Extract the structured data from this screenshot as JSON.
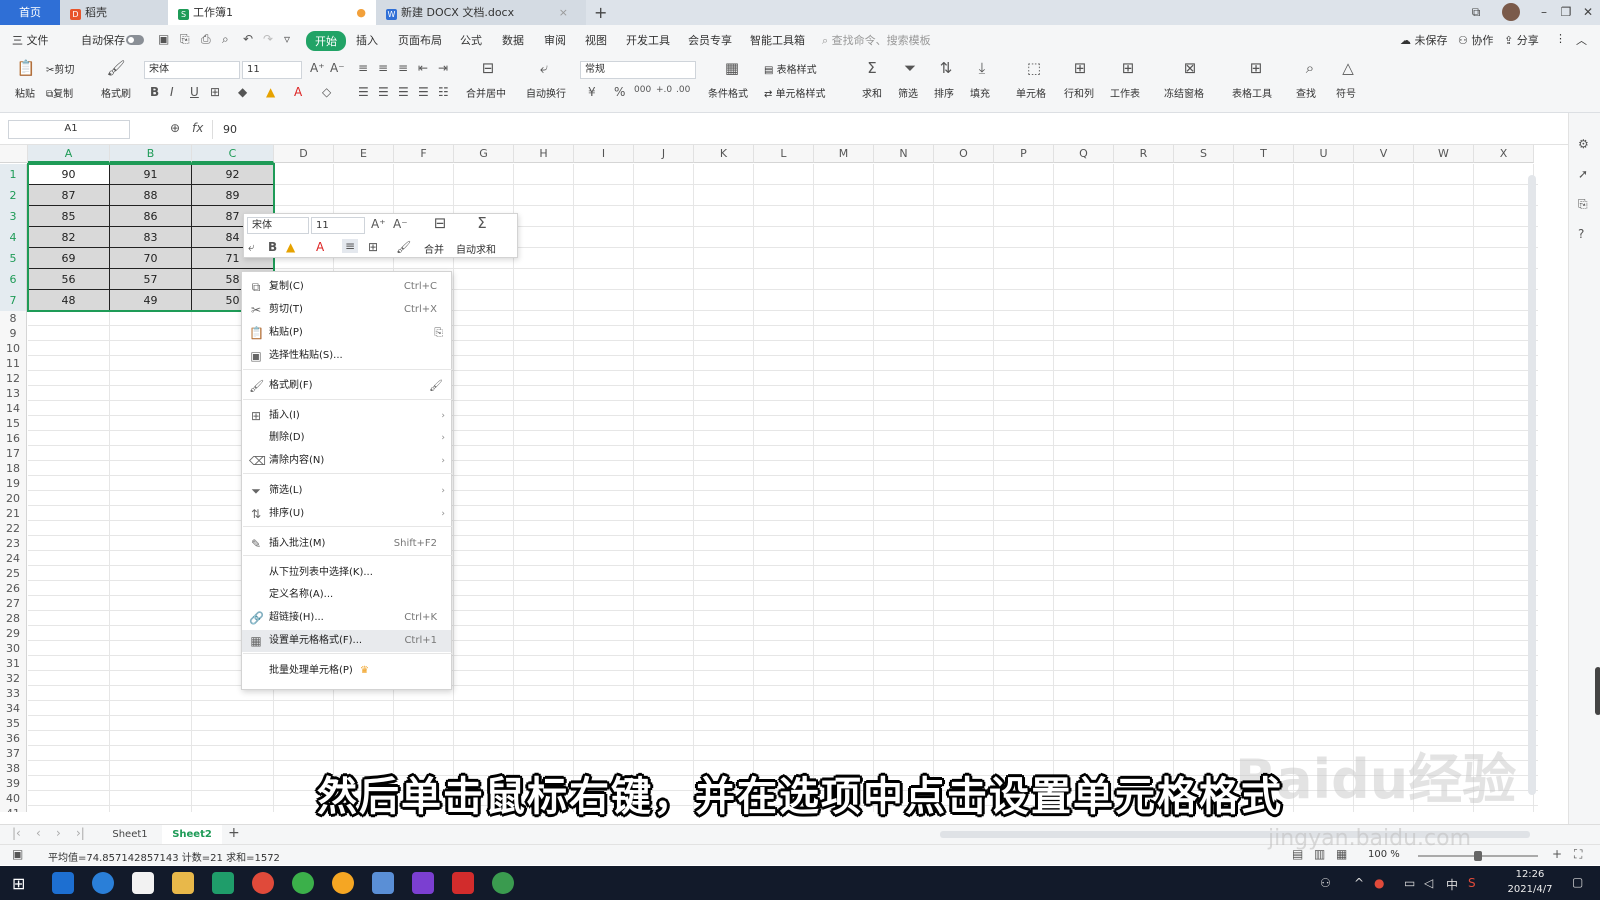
{
  "tabs": {
    "home": "首页",
    "wk": "稻壳",
    "book": "工作簿1",
    "doc": "新建 DOCX 文档.docx",
    "new_tab": "+"
  },
  "menubar": {
    "file": "三 文件",
    "autosave": "自动保存",
    "items": [
      "开始",
      "插入",
      "页面布局",
      "公式",
      "数据",
      "审阅",
      "视图",
      "开发工具",
      "会员专享",
      "智能工具箱"
    ],
    "search": "查找命令、搜索模板",
    "unsaved": "未保存",
    "collab": "协作",
    "share": "分享"
  },
  "ribbon": {
    "paste": "粘贴",
    "cut": "剪切",
    "copy": "复制",
    "format_painter": "格式刷",
    "font_name": "宋体",
    "font_size": "11",
    "merge_center": "合并居中",
    "wrap": "自动换行",
    "number_format": "常规",
    "cond_format": "条件格式",
    "table_style": "表格样式",
    "cell_style": "单元格样式",
    "sum": "求和",
    "filter": "筛选",
    "sort": "排序",
    "fill": "填充",
    "cell": "单元格",
    "row_col": "行和列",
    "sheet": "工作表",
    "freeze": "冻结窗格",
    "table_tools": "表格工具",
    "find": "查找",
    "symbol": "符号",
    "currency": "¥",
    "percent": "%",
    "thousands": "000",
    "inc_dec": "+.0",
    "dec_dec": ".00"
  },
  "formula": {
    "name_box": "A1",
    "fx": "fx",
    "value": "90"
  },
  "columns": [
    "A",
    "B",
    "C",
    "D",
    "E",
    "F",
    "G",
    "H",
    "I",
    "J",
    "K",
    "L",
    "M",
    "N",
    "O",
    "P",
    "Q",
    "R",
    "S",
    "T",
    "U",
    "V",
    "W",
    "X"
  ],
  "rows": [
    "1",
    "2",
    "3",
    "4",
    "5",
    "6",
    "7",
    "8",
    "9",
    "10",
    "11",
    "12",
    "13",
    "14",
    "15",
    "16",
    "17",
    "18",
    "19",
    "20",
    "21",
    "22",
    "23",
    "24",
    "25",
    "26",
    "27",
    "28",
    "29",
    "30",
    "31",
    "32",
    "33",
    "34",
    "35",
    "36",
    "37",
    "38",
    "39",
    "40",
    "41"
  ],
  "cells": [
    [
      "90",
      "91",
      "92"
    ],
    [
      "87",
      "88",
      "89"
    ],
    [
      "85",
      "86",
      "87"
    ],
    [
      "82",
      "83",
      "84"
    ],
    [
      "69",
      "70",
      "71"
    ],
    [
      "56",
      "57",
      "58"
    ],
    [
      "48",
      "49",
      "50"
    ]
  ],
  "mini_toolbar": {
    "font": "宋体",
    "size": "11",
    "merge": "合并",
    "autosum": "自动求和"
  },
  "context_menu": [
    {
      "label": "复制(C)",
      "shortcut": "Ctrl+C",
      "icon": "copy-icon"
    },
    {
      "label": "剪切(T)",
      "shortcut": "Ctrl+X",
      "icon": "scissors-icon"
    },
    {
      "label": "粘贴(P)",
      "shortcut": "",
      "icon": "paste-icon"
    },
    {
      "label": "选择性粘贴(S)...",
      "shortcut": "",
      "icon": "paste-special-icon"
    },
    {
      "label": "格式刷(F)",
      "shortcut": "",
      "icon": "format-painter-icon"
    },
    {
      "label": "插入(I)",
      "shortcut": "",
      "icon": "insert-icon"
    },
    {
      "label": "删除(D)",
      "shortcut": "",
      "icon": ""
    },
    {
      "label": "清除内容(N)",
      "shortcut": "",
      "icon": "eraser-icon"
    },
    {
      "label": "筛选(L)",
      "shortcut": "",
      "icon": "filter-icon"
    },
    {
      "label": "排序(U)",
      "shortcut": "",
      "icon": "sort-icon"
    },
    {
      "label": "插入批注(M)",
      "shortcut": "Shift+F2",
      "icon": "comment-icon"
    },
    {
      "label": "从下拉列表中选择(K)...",
      "shortcut": "",
      "icon": ""
    },
    {
      "label": "定义名称(A)...",
      "shortcut": "",
      "icon": ""
    },
    {
      "label": "超链接(H)...",
      "shortcut": "Ctrl+K",
      "icon": "link-icon"
    },
    {
      "label": "设置单元格格式(F)...",
      "shortcut": "Ctrl+1",
      "icon": "format-cells-icon"
    },
    {
      "label": "批量处理单元格(P)",
      "shortcut": "",
      "icon": "crown-icon"
    }
  ],
  "sheets": {
    "sheet1": "Sheet1",
    "sheet2": "Sheet2",
    "add": "+"
  },
  "status": {
    "stats": "平均值=74.857142857143  计数=21  求和=1572",
    "zoom": "100 %"
  },
  "subtitle": "然后单击鼠标右键，并在选项中点击设置单元格格式",
  "watermark": {
    "brand": "Baidu经验",
    "url": "jingyan.baidu.com"
  },
  "clock": {
    "time": "12:26",
    "date": "2021/4/7"
  },
  "colors": {
    "accent": "#1e9b57",
    "tab_blue": "#2f6fd6",
    "selection": "#d9d9d9"
  }
}
